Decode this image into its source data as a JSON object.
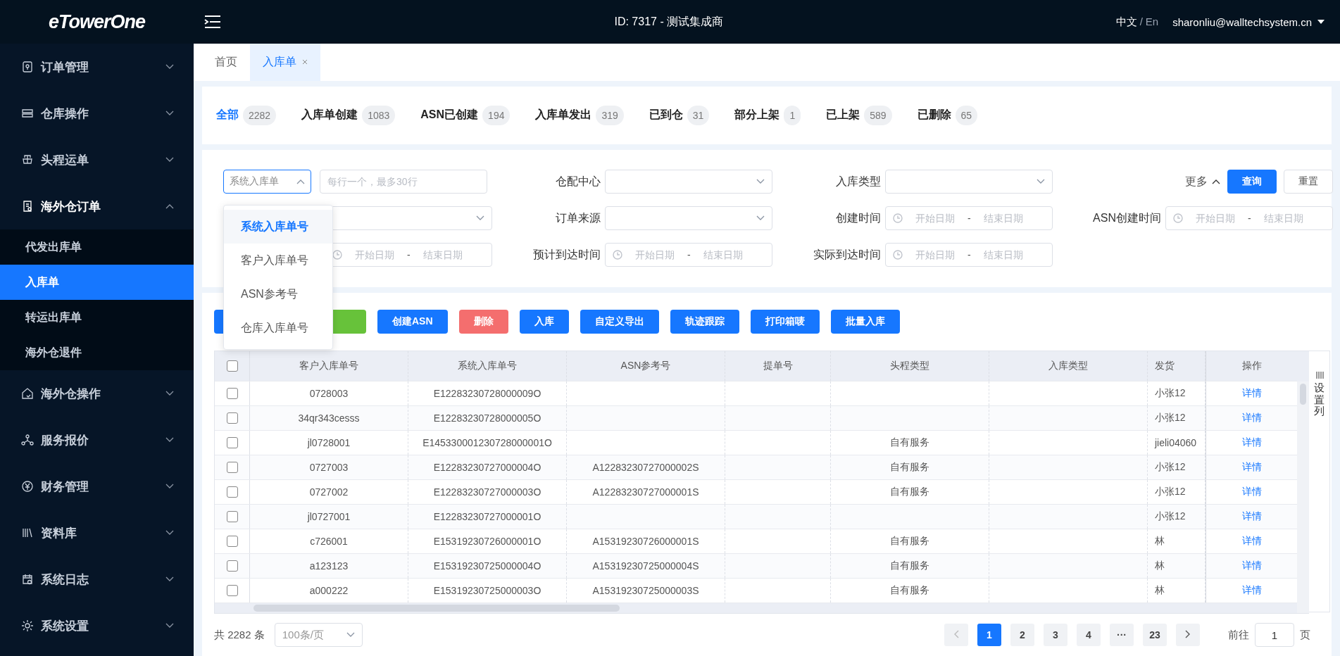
{
  "header": {
    "logo": "eTowerOne",
    "title": "ID: 7317 - 测试集成商",
    "languages": [
      {
        "label": "中文",
        "selected": true
      },
      {
        "label": "En",
        "selected": false
      }
    ],
    "language_separator": "/",
    "user": "sharonliu@walltechsystem.cn"
  },
  "sidebar": {
    "items": [
      {
        "label": "订单管理",
        "expanded": false
      },
      {
        "label": "仓库操作",
        "expanded": false
      },
      {
        "label": "头程运单",
        "expanded": false
      },
      {
        "label": "海外仓订单",
        "expanded": true,
        "children": [
          {
            "label": "代发出库单",
            "selected": false
          },
          {
            "label": "入库单",
            "selected": true
          },
          {
            "label": "转运出库单",
            "selected": false
          },
          {
            "label": "海外仓退件",
            "selected": false
          }
        ]
      },
      {
        "label": "海外仓操作",
        "expanded": false
      },
      {
        "label": "服务报价",
        "expanded": false
      },
      {
        "label": "财务管理",
        "expanded": false
      },
      {
        "label": "资料库",
        "expanded": false
      },
      {
        "label": "系统日志",
        "expanded": false
      },
      {
        "label": "系统设置",
        "expanded": false
      }
    ]
  },
  "page_tabs": [
    {
      "label": "首页",
      "selected": false,
      "closable": false
    },
    {
      "label": "入库单",
      "selected": true,
      "closable": true
    }
  ],
  "status_tabs": [
    {
      "label": "全部",
      "count": "2282",
      "selected": true
    },
    {
      "label": "入库单创建",
      "count": "1083",
      "selected": false
    },
    {
      "label": "ASN已创建",
      "count": "194",
      "selected": false
    },
    {
      "label": "入库单发出",
      "count": "319",
      "selected": false
    },
    {
      "label": "已到仓",
      "count": "31",
      "selected": false
    },
    {
      "label": "部分上架",
      "count": "1",
      "selected": false
    },
    {
      "label": "已上架",
      "count": "589",
      "selected": false
    },
    {
      "label": "已删除",
      "count": "65",
      "selected": false
    }
  ],
  "filter_rows": [
    [
      {
        "kind": "keyselect",
        "value": "系统入库单",
        "open": true,
        "placeholder": "每行一个，最多30行",
        "options": [
          {
            "label": "系统入库单号",
            "selected": true
          },
          {
            "label": "客户入库单号",
            "selected": false
          },
          {
            "label": "ASN参考号",
            "selected": false
          },
          {
            "label": "仓库入库单号",
            "selected": false
          }
        ]
      },
      {
        "kind": "select",
        "label": "仓配中心"
      },
      {
        "kind": "select",
        "label": "入库类型"
      },
      {
        "kind": "actions",
        "more": "更多",
        "search": "查询",
        "reset": "重置"
      }
    ],
    [
      {
        "kind": "select"
      },
      {
        "kind": "select",
        "label": "订单来源"
      },
      {
        "kind": "daterange",
        "label": "创建时间",
        "start_placeholder": "开始日期",
        "separator": "-",
        "end_placeholder": "结束日期"
      },
      {
        "kind": "daterange",
        "label": "ASN创建时间",
        "start_placeholder": "开始日期",
        "separator": "-",
        "end_placeholder": "结束日期"
      }
    ],
    [
      {
        "kind": "daterange",
        "start_placeholder": "开始日期",
        "separator": "-",
        "end_placeholder": "结束日期"
      },
      {
        "kind": "daterange",
        "label": "预计到达时间",
        "start_placeholder": "开始日期",
        "separator": "-",
        "end_placeholder": "结束日期"
      },
      {
        "kind": "daterange",
        "label": "实际到达时间",
        "start_placeholder": "开始日期",
        "separator": "-",
        "end_placeholder": "结束日期"
      }
    ]
  ],
  "buttons": [
    {
      "kind": "primary"
    },
    {
      "kind": "success"
    },
    {
      "label": "创建ASN",
      "kind": "primary"
    },
    {
      "label": "删除",
      "kind": "danger"
    },
    {
      "label": "入库",
      "kind": "primary"
    },
    {
      "label": "自定义导出",
      "kind": "primary"
    },
    {
      "label": "轨迹跟踪",
      "kind": "primary"
    },
    {
      "label": "打印箱唛",
      "kind": "primary"
    },
    {
      "label": "批量入库",
      "kind": "primary"
    }
  ],
  "table": {
    "all_checked": false,
    "columns": [
      "客户入库单号",
      "系统入库单号",
      "ASN参考号",
      "提单号",
      "头程类型",
      "入库类型",
      "发货"
    ],
    "action_column": "操作",
    "settings": "设置列",
    "rows": [
      {
        "checked": false,
        "cells": [
          "0728003",
          "E12283230728000009O",
          null,
          null,
          null,
          null,
          "小张12"
        ],
        "action": "详情"
      },
      {
        "checked": false,
        "cells": [
          "34qr343cesss",
          "E12283230728000005O",
          null,
          null,
          null,
          null,
          "小张12"
        ],
        "action": "详情"
      },
      {
        "checked": false,
        "cells": [
          "jl0728001",
          "E145330001230728000001O",
          null,
          null,
          "自有服务",
          null,
          "jieli04060"
        ],
        "action": "详情"
      },
      {
        "checked": false,
        "cells": [
          "0727003",
          "E12283230727000004O",
          "A12283230727000002S",
          null,
          "自有服务",
          null,
          "小张12"
        ],
        "action": "详情"
      },
      {
        "checked": false,
        "cells": [
          "0727002",
          "E12283230727000003O",
          "A12283230727000001S",
          null,
          "自有服务",
          null,
          "小张12"
        ],
        "action": "详情"
      },
      {
        "checked": false,
        "cells": [
          "jl0727001",
          "E12283230727000001O",
          null,
          null,
          null,
          null,
          "小张12"
        ],
        "action": "详情"
      },
      {
        "checked": false,
        "cells": [
          "c726001",
          "E15319230726000001O",
          "A15319230726000001S",
          null,
          "自有服务",
          null,
          "林"
        ],
        "action": "详情"
      },
      {
        "checked": false,
        "cells": [
          "a123123",
          "E15319230725000004O",
          "A15319230725000004S",
          null,
          "自有服务",
          null,
          "林"
        ],
        "action": "详情"
      },
      {
        "checked": false,
        "cells": [
          "a000222",
          "E15319230725000003O",
          "A15319230725000003S",
          null,
          "自有服务",
          null,
          "林"
        ],
        "action": "详情"
      }
    ]
  },
  "pagination": {
    "total": "共 2282 条",
    "page_size": "100条/页",
    "pages": [
      {
        "label": "1",
        "selected": true
      },
      {
        "label": "2",
        "selected": false
      },
      {
        "label": "3",
        "selected": false
      },
      {
        "label": "4",
        "selected": false
      },
      {
        "label": "···",
        "selected": false
      },
      {
        "label": "23",
        "selected": false
      }
    ],
    "goto_label": "前往",
    "goto_value": "1",
    "goto_suffix": "页"
  }
}
